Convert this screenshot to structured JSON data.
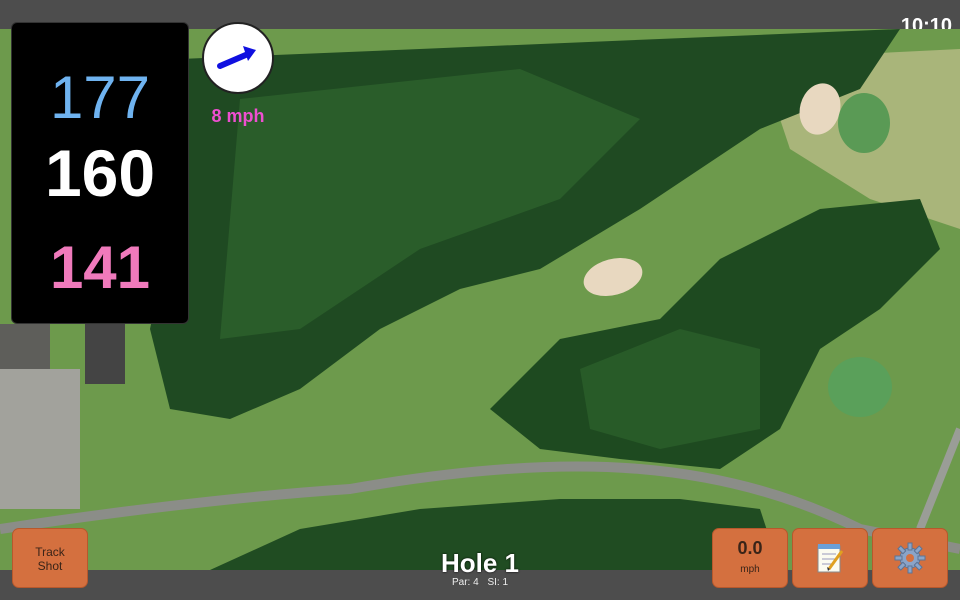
{
  "status": {
    "time": "10:10"
  },
  "yardage": {
    "back": "177",
    "center": "160",
    "front": "141"
  },
  "wind": {
    "speed": "8 mph",
    "icon": "wind-arrow-icon",
    "arrow_color": "#1010e0"
  },
  "hole": {
    "title": "Hole 1",
    "par": "Par: 4",
    "si": "SI: 1"
  },
  "buttons": {
    "track_line1": "Track",
    "track_line2": "Shot",
    "speed_value": "0.0",
    "speed_unit": "mph",
    "notes_icon": "notepad-icon",
    "settings_icon": "gear-icon"
  },
  "colors": {
    "button": "#d4703f",
    "back_yardage": "#6fb3f0",
    "front_yardage": "#f07abc",
    "wind_text": "#ee4fd0"
  }
}
